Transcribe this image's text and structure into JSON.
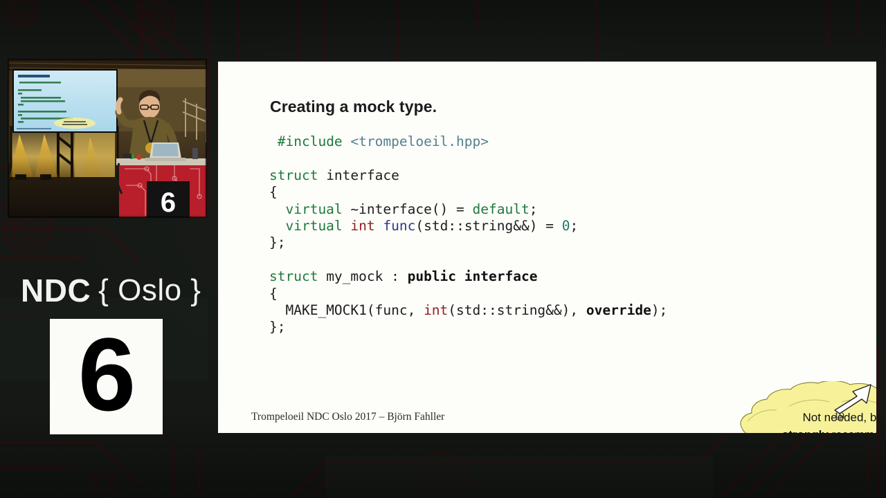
{
  "background": {
    "style_name": "circuit-board-pattern",
    "base_color": "#151815",
    "trace_color": "#2a0f0f"
  },
  "thumbnail": {
    "name": "conference-stage-photo",
    "description": "Speaker on stage in front of a projected slide",
    "podium_number": "6"
  },
  "branding": {
    "logo_bold": "NDC",
    "logo_light": "{ Oslo }",
    "track_number": "6"
  },
  "slide": {
    "title": "Creating a mock type.",
    "background_color": "#fdfdfa",
    "code_lines": [
      {
        "indent": 1,
        "tokens": [
          {
            "t": "#include ",
            "c": "kw"
          },
          {
            "t": "<trompeloeil.hpp>",
            "c": "hdr"
          }
        ]
      },
      {
        "indent": 0,
        "tokens": []
      },
      {
        "indent": 0,
        "tokens": [
          {
            "t": "struct",
            "c": "kw"
          },
          {
            "t": " interface",
            "c": ""
          }
        ]
      },
      {
        "indent": 0,
        "tokens": [
          {
            "t": "{",
            "c": ""
          }
        ]
      },
      {
        "indent": 0,
        "tokens": [
          {
            "t": "  ",
            "c": ""
          },
          {
            "t": "virtual",
            "c": "kw"
          },
          {
            "t": " ~interface() = ",
            "c": ""
          },
          {
            "t": "default",
            "c": "kw"
          },
          {
            "t": ";",
            "c": ""
          }
        ]
      },
      {
        "indent": 0,
        "tokens": [
          {
            "t": "  ",
            "c": ""
          },
          {
            "t": "virtual",
            "c": "kw"
          },
          {
            "t": " ",
            "c": ""
          },
          {
            "t": "int",
            "c": "type"
          },
          {
            "t": " ",
            "c": ""
          },
          {
            "t": "func",
            "c": "fn"
          },
          {
            "t": "(std::string&&) = ",
            "c": ""
          },
          {
            "t": "0",
            "c": "num-lit"
          },
          {
            "t": ";",
            "c": ""
          }
        ]
      },
      {
        "indent": 0,
        "tokens": [
          {
            "t": "};",
            "c": ""
          }
        ]
      },
      {
        "indent": 0,
        "tokens": []
      },
      {
        "indent": 0,
        "tokens": [
          {
            "t": "struct",
            "c": "kw"
          },
          {
            "t": " my_mock : ",
            "c": ""
          },
          {
            "t": "public interface",
            "c": "bold"
          }
        ]
      },
      {
        "indent": 0,
        "tokens": [
          {
            "t": "{",
            "c": ""
          }
        ]
      },
      {
        "indent": 0,
        "tokens": [
          {
            "t": "  MAKE_MOCK1(func, ",
            "c": ""
          },
          {
            "t": "int",
            "c": "type"
          },
          {
            "t": "(std::string&&), ",
            "c": ""
          },
          {
            "t": "override",
            "c": "bold"
          },
          {
            "t": ");",
            "c": ""
          }
        ]
      },
      {
        "indent": 0,
        "tokens": [
          {
            "t": "};",
            "c": ""
          }
        ]
      }
    ],
    "callout": {
      "line1": "Not needed, but",
      "line2_bold": "strongly",
      "line2_rest": " recommended",
      "fill_color": "#f7f29a",
      "stroke_color": "#7a7a30",
      "arrow_name": "callout-arrow-up-right"
    },
    "footer": {
      "credit": "Trompeloeil NDC Oslo 2017 – Björn Fahller",
      "page_number": "19"
    }
  }
}
